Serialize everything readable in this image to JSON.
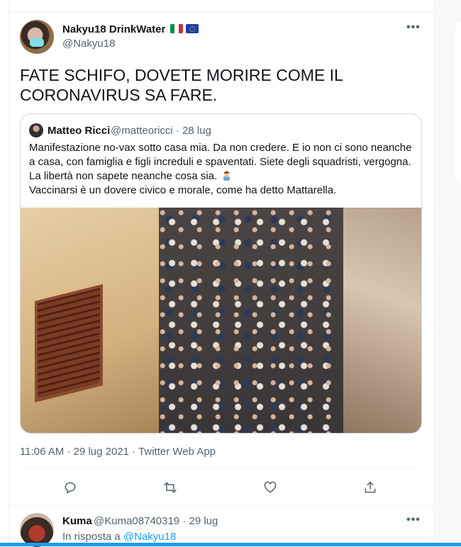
{
  "tweet": {
    "display_name": "Nakyu18 DrinkWater",
    "handle": "@Nakyu18",
    "text_lines": [
      "FATE SCHIFO, DOVETE MORIRE COME IL",
      "CORONAVIRUS SA FARE."
    ],
    "timestamp": "11:06 AM · 29 lug 2021 · Twitter Web App",
    "more_icon": "more-horizontal-icon",
    "flag_icons": [
      "italy-flag-icon",
      "eu-flag-icon"
    ]
  },
  "quote": {
    "display_name": "Matteo Ricci",
    "handle_date": "@matteoricci · 28 lug",
    "text_lines": [
      "Manifestazione no-vax sotto casa mia. Da non credere. E io non ci sono neanche",
      "a casa, con famiglia e figli increduli e spaventati. Siete degli squadristi, vergogna.",
      "La libertà non sapete neanche cosa sia.",
      "Vaccinarsi è un dovere civico e morale, come ha detto Mattarella."
    ],
    "emoji_icon": "man-facepalming-emoji",
    "media_icon": "photo-crowd-in-street"
  },
  "actions": [
    {
      "name": "reply-icon"
    },
    {
      "name": "retweet-icon"
    },
    {
      "name": "like-icon"
    },
    {
      "name": "share-icon"
    }
  ],
  "reply": {
    "display_name": "Kuma",
    "handle_date": "@Kuma08740319 · 29 lug",
    "in_reply_prefix": "In risposta a",
    "in_reply_handle": "@Nakyu18"
  },
  "colors": {
    "accent": "#1d9bf0",
    "secondary_text": "#536471",
    "border": "#eff3f4"
  }
}
